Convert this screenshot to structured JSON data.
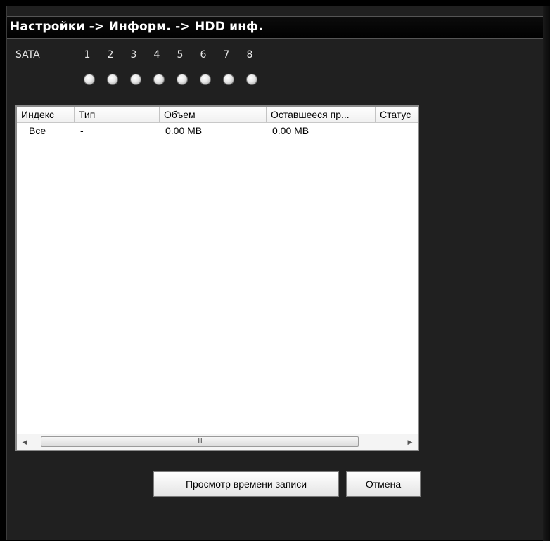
{
  "window": {
    "title": "Настройки -> Информ. -> HDD инф."
  },
  "sata": {
    "label": "SATA",
    "ports": [
      "1",
      "2",
      "3",
      "4",
      "5",
      "6",
      "7",
      "8"
    ]
  },
  "table": {
    "columns": [
      "Индекс",
      "Тип",
      "Объем",
      "Оставшееся пр...",
      "Статус"
    ],
    "rows": [
      {
        "index": "Все",
        "type": "-",
        "capacity": "0.00 MB",
        "remaining": "0.00 MB",
        "status": ""
      }
    ],
    "scroll_grip": "III",
    "scroll_left": "◀",
    "scroll_right": "▶"
  },
  "buttons": {
    "view_record_time": "Просмотр времени записи",
    "cancel": "Отмена"
  },
  "colors": {
    "background": "#202020",
    "titlebar": "#000000",
    "port_indicator": "#e8e8e8"
  }
}
